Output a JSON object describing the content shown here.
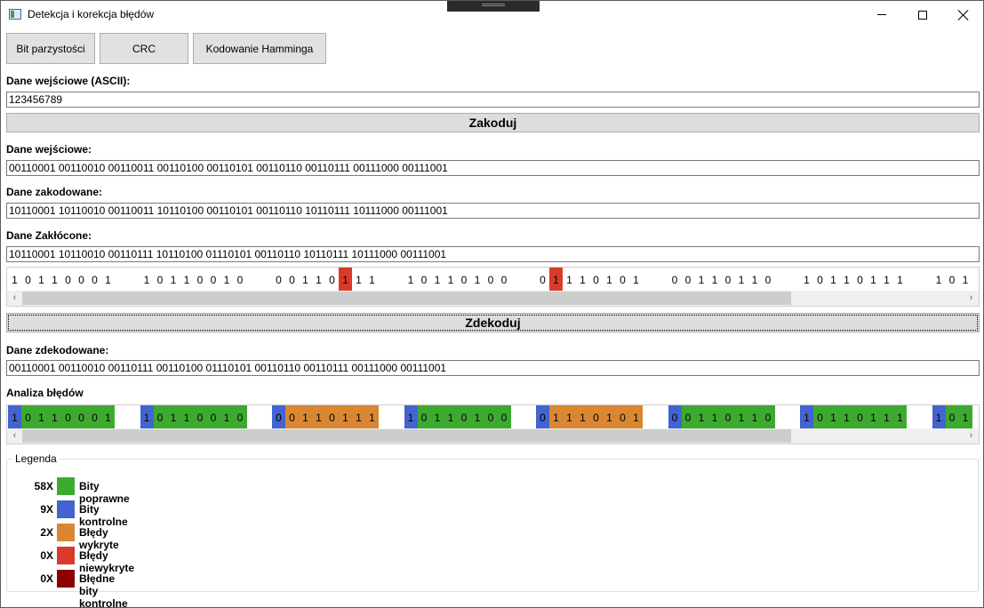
{
  "window": {
    "title": "Detekcja i korekcja błędów"
  },
  "tabs": [
    {
      "label": "Bit parzystości"
    },
    {
      "label": "CRC"
    },
    {
      "label": "Kodowanie Hamminga"
    }
  ],
  "input": {
    "label": "Dane wejściowe (ASCII):",
    "value": "123456789"
  },
  "encode_button": "Zakoduj",
  "input_bits": {
    "label": "Dane wejściowe:",
    "value": "00110001 00110010 00110011 00110100 00110101 00110110 00110111 00111000 00111001"
  },
  "encoded": {
    "label": "Dane zakodowane:",
    "value": "10110001 10110010 00110011 10110100 00110101 00110110 10110111 10111000 00111001"
  },
  "noisy": {
    "label": "Dane Zakłócone:",
    "value": "10110001 10110010 00110111 10110100 01110101 00110110 10110111 10111000 00111001"
  },
  "noisy_strip": {
    "bytes": [
      "10110001",
      "10110010",
      "00110111",
      "10110100",
      "01110101",
      "00110110",
      "10110111",
      "101"
    ],
    "flipped": [
      [
        2,
        5
      ],
      [
        4,
        1
      ]
    ]
  },
  "decode_button": "Zdekoduj",
  "decoded": {
    "label": "Dane zdekodowane:",
    "value": "00110001 00110010 00110111 00110100 01110101 00110110 00110111 00111000 00111001"
  },
  "analysis": {
    "label": "Analiza błędów",
    "bytes": [
      {
        "bits": "10110001",
        "status": "ok"
      },
      {
        "bits": "10110010",
        "status": "ok"
      },
      {
        "bits": "00110111",
        "status": "detected"
      },
      {
        "bits": "10110100",
        "status": "ok"
      },
      {
        "bits": "01110101",
        "status": "detected"
      },
      {
        "bits": "00110110",
        "status": "ok"
      },
      {
        "bits": "10110111",
        "status": "ok"
      },
      {
        "bits": "101",
        "status": "ok"
      }
    ]
  },
  "colors": {
    "correct": "#3daa2f",
    "control": "#4363d0",
    "detected": "#d98732",
    "undetected": "#d93a2a",
    "bad_control": "#8b0000"
  },
  "legend": {
    "title": "Legenda",
    "items": [
      {
        "count": "58X",
        "label": "Bity poprawne",
        "color": "#3daa2f"
      },
      {
        "count": "9X",
        "label": "Bity kontrolne",
        "color": "#4363d0"
      },
      {
        "count": "2X",
        "label": "Błędy wykryte",
        "color": "#d98732"
      },
      {
        "count": "0X",
        "label": "Błędy niewykryte",
        "color": "#d93a2a"
      },
      {
        "count": "0X",
        "label": "Błędne bity kontrolne",
        "color": "#8b0000"
      }
    ]
  },
  "scroll_arrows": {
    "left": "‹",
    "right": "›"
  }
}
